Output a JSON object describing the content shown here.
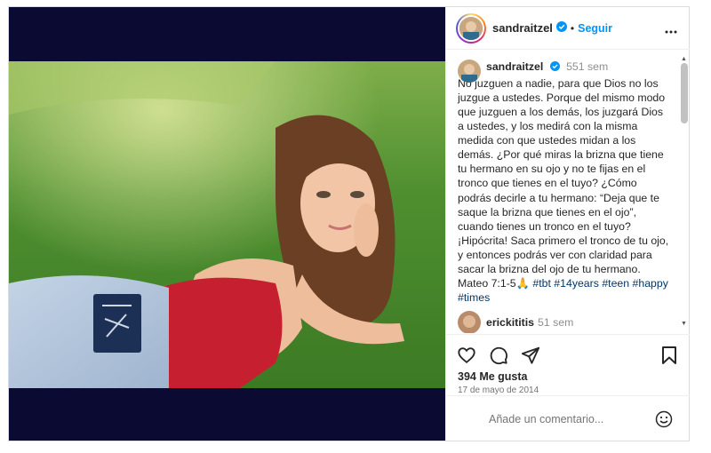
{
  "post": {
    "username": "sandraitzel",
    "follow_label": "Seguir",
    "dot": "•",
    "caption_time": "551 sem",
    "caption_text": "No juzguen a nadie, para que Dios no los juzgue a ustedes. Porque del mismo modo que juzguen a los demás, los juzgará Dios a ustedes, y los medirá con la misma medida con que ustedes midan a los demás. ¿Por qué miras la brizna que tiene tu hermano en su ojo y no te fijas en el tronco que tienes en el tuyo? ¿Cómo podrás decirle a tu hermano: “Deja que te saque la brizna que tienes en el ojo”, cuando tienes un tronco en el tuyo? ¡Hipócrita! Saca primero el tronco de tu ojo, y entonces podrás ver con claridad para sacar la brizna del ojo de tu hermano. Mateo 7:1-5🙏 ",
    "hashtags": [
      "#tbt",
      "#14years",
      "#teen",
      "#happy",
      "#times"
    ],
    "likes": "394 Me gusta",
    "date": "17 de mayo de 2014"
  },
  "comment2": {
    "username": "erickititis",
    "time": "51 sem"
  },
  "add_comment": {
    "placeholder": "Añade un comentario..."
  },
  "icons": {
    "verified": "verified-badge-icon",
    "more": "more-options-icon",
    "like": "heart-icon",
    "comment": "comment-icon",
    "share": "share-icon",
    "save": "bookmark-icon",
    "emoji": "emoji-icon"
  },
  "colors": {
    "accent": "#0095f6",
    "hashtag": "#00376b",
    "media_bg": "#0a0a33",
    "secondary_text": "#8e8e8e"
  }
}
